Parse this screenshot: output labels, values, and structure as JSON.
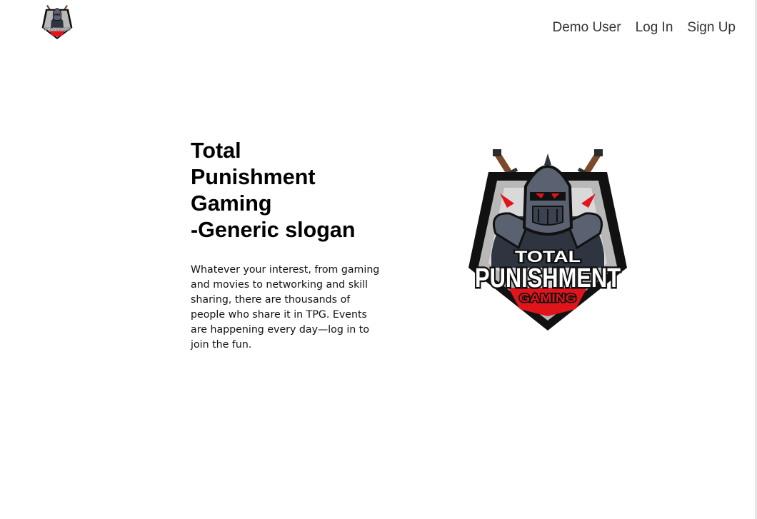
{
  "header": {
    "logo_text": "TOTAL PUNISHMENT",
    "nav": [
      {
        "label": "Demo User"
      },
      {
        "label": "Log In"
      },
      {
        "label": "Sign Up"
      }
    ]
  },
  "hero": {
    "title_lines": [
      "Total",
      "Punishment",
      "Gaming",
      "-Generic slogan"
    ],
    "description": "Whatever your interest, from gaming and movies to networking and skill sharing, there are thousands of people who share it in TPG. Events are happening every day—log in to join the fun.",
    "logo_text": {
      "line1": "TOTAL",
      "line2": "PUNISHMENT",
      "line3": "GAMING"
    }
  },
  "colors": {
    "brand_red": "#e0151b",
    "armor_dark": "#2e3440",
    "armor_mid": "#5a6272",
    "shield_grey": "#b8b8b8",
    "nav_text": "#333333"
  }
}
